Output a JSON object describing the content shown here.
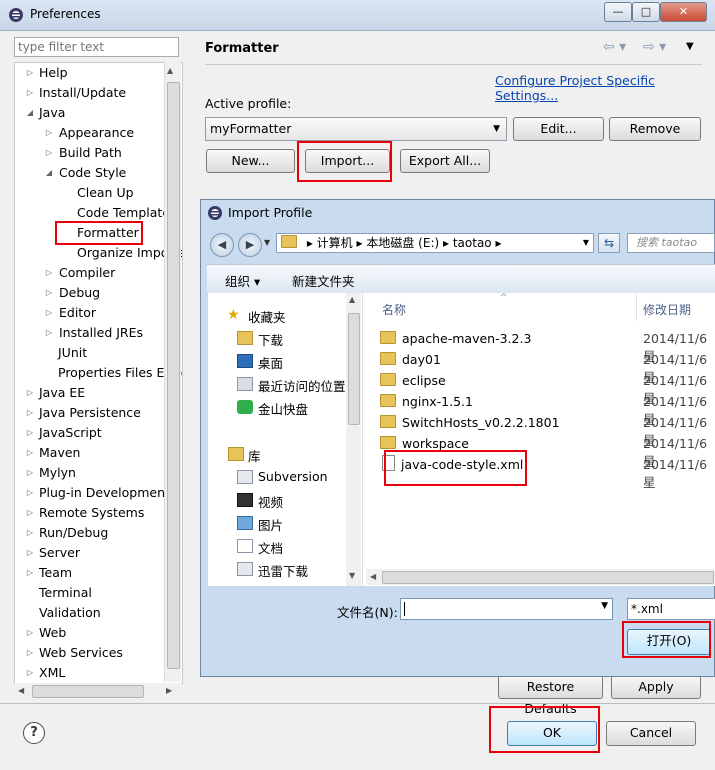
{
  "window": {
    "title": "Preferences",
    "minimize": "—",
    "maximize": "□",
    "close": "✕"
  },
  "filter": {
    "placeholder": "type filter text"
  },
  "tree": {
    "items": [
      {
        "label": "Help"
      },
      {
        "label": "Install/Update"
      },
      {
        "label": "Java"
      },
      {
        "label": "Appearance"
      },
      {
        "label": "Build Path"
      },
      {
        "label": "Code Style"
      },
      {
        "label": "Clean Up"
      },
      {
        "label": "Code Templates"
      },
      {
        "label": "Formatter"
      },
      {
        "label": "Organize Imports"
      },
      {
        "label": "Compiler"
      },
      {
        "label": "Debug"
      },
      {
        "label": "Editor"
      },
      {
        "label": "Installed JREs"
      },
      {
        "label": "JUnit"
      },
      {
        "label": "Properties Files Editor"
      },
      {
        "label": "Java EE"
      },
      {
        "label": "Java Persistence"
      },
      {
        "label": "JavaScript"
      },
      {
        "label": "Maven"
      },
      {
        "label": "Mylyn"
      },
      {
        "label": "Plug-in Development"
      },
      {
        "label": "Remote Systems"
      },
      {
        "label": "Run/Debug"
      },
      {
        "label": "Server"
      },
      {
        "label": "Team"
      },
      {
        "label": "Terminal"
      },
      {
        "label": "Validation"
      },
      {
        "label": "Web"
      },
      {
        "label": "Web Services"
      },
      {
        "label": "XML"
      }
    ]
  },
  "formatter": {
    "heading": "Formatter",
    "configure_link": "Configure Project Specific Settings...",
    "active_profile_label": "Active profile:",
    "profile_value": "myFormatter",
    "edit_button": "Edit...",
    "remove_button": "Remove",
    "new_button": "New...",
    "import_button": "Import...",
    "export_button": "Export All..."
  },
  "footer": {
    "restore_defaults": "Restore Defaults",
    "apply": "Apply",
    "ok": "OK",
    "cancel": "Cancel",
    "help": "?"
  },
  "dialog": {
    "title": "Import Profile",
    "breadcrumb": [
      "计算机",
      "本地磁盘 (E:)",
      "taotao"
    ],
    "search_placeholder": "搜索 taotao",
    "toolbar": {
      "organize": "组织 ▾",
      "new_folder": "新建文件夹"
    },
    "nav": {
      "favorites_header": "收藏夹",
      "favorites": [
        "下载",
        "桌面",
        "最近访问的位置",
        "金山快盘"
      ],
      "libraries_header": "库",
      "libraries": [
        "Subversion",
        "视频",
        "图片",
        "文档",
        "迅雷下载"
      ]
    },
    "columns": {
      "name": "名称",
      "modified": "修改日期"
    },
    "files": [
      {
        "name": "apache-maven-3.2.3",
        "date": "2014/11/6 星"
      },
      {
        "name": "day01",
        "date": "2014/11/6 星"
      },
      {
        "name": "eclipse",
        "date": "2014/11/6 星"
      },
      {
        "name": "nginx-1.5.1",
        "date": "2014/11/6 星"
      },
      {
        "name": "SwitchHosts_v0.2.2.1801",
        "date": "2014/11/6 星"
      },
      {
        "name": "workspace",
        "date": "2014/11/6 星"
      },
      {
        "name": "java-code-style.xml",
        "date": "2014/11/6 星"
      }
    ],
    "filename_label": "文件名(N):",
    "filename_value": "",
    "filetype": "*.xml",
    "open_button": "打开(O)"
  }
}
